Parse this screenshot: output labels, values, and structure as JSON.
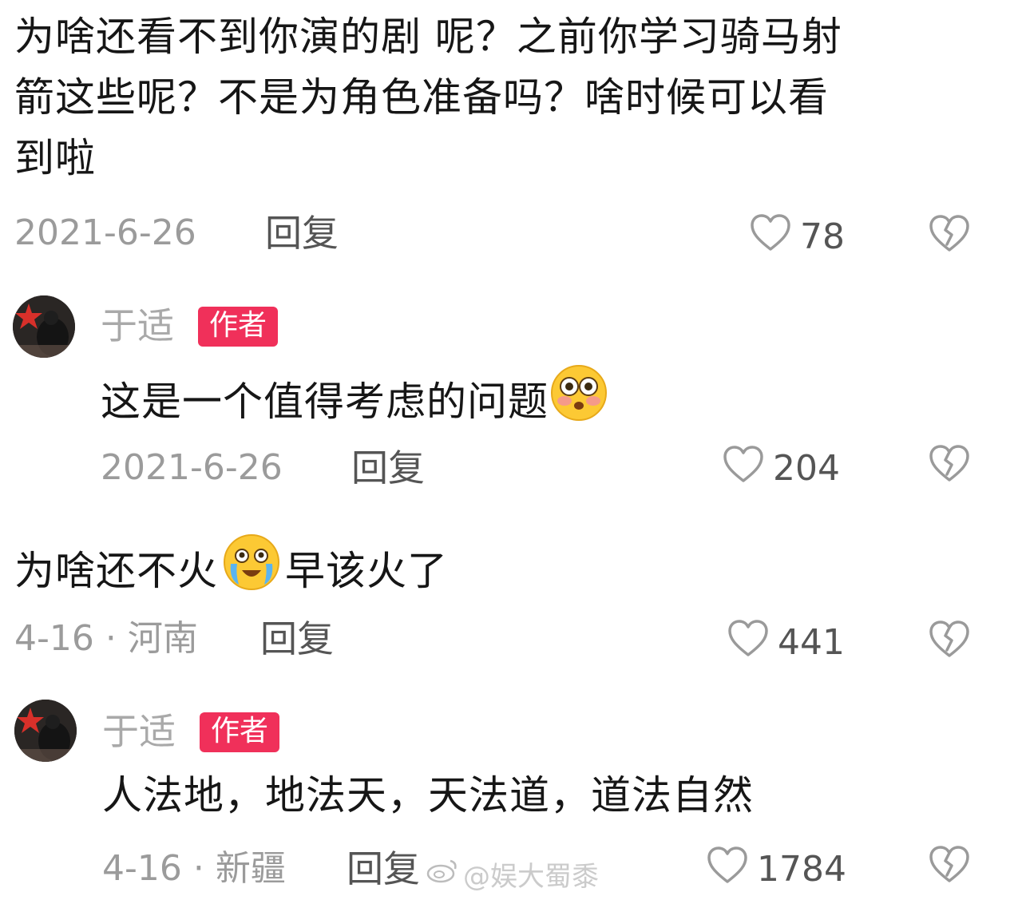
{
  "comments": [
    {
      "text_lines": [
        "为啥还看不到你演的剧 呢？之前你学习骑马射",
        "箭这些呢？不是为角色准备吗？啥时候可以看",
        "到啦"
      ],
      "meta": "2021-6-26",
      "reply_label": "回复",
      "likes": "78"
    },
    {
      "author": "于适",
      "author_badge": "作者",
      "text": "这是一个值得考虑的问题",
      "emoji": "flushed-face",
      "meta": "2021-6-26",
      "reply_label": "回复",
      "likes": "204"
    },
    {
      "text_before": "为啥还不火",
      "emoji": "crying-face",
      "text_after": "早该火了",
      "meta": "4-16 · 河南",
      "reply_label": "回复",
      "likes": "441"
    },
    {
      "author": "于适",
      "author_badge": "作者",
      "text": "人法地，地法天，天法道，道法自然",
      "meta": "4-16 · 新疆",
      "reply_label": "回复",
      "likes": "1784"
    }
  ],
  "watermark": "@娱大蜀黍",
  "colors": {
    "badge": "#f0305a",
    "meta_text": "#9b9b9b",
    "body_text": "#161616"
  }
}
